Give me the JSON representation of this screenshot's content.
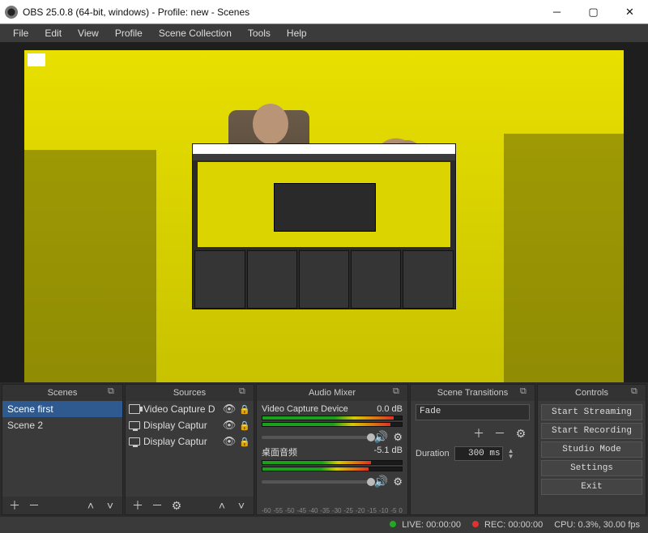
{
  "window": {
    "title": "OBS 25.0.8 (64-bit, windows) - Profile: new - Scenes"
  },
  "menu": [
    "File",
    "Edit",
    "View",
    "Profile",
    "Scene Collection",
    "Tools",
    "Help"
  ],
  "panels": {
    "scenes": {
      "title": "Scenes",
      "items": [
        "Scene first",
        "Scene 2"
      ],
      "selected": 0
    },
    "sources": {
      "title": "Sources",
      "items": [
        {
          "type": "cap",
          "label": "Video Capture D"
        },
        {
          "type": "disp",
          "label": "Display Captur"
        },
        {
          "type": "disp",
          "label": "Display Captur"
        }
      ]
    },
    "mixer": {
      "title": "Audio Mixer",
      "ticks": [
        "-60",
        "-55",
        "-50",
        "-45",
        "-40",
        "-35",
        "-30",
        "-25",
        "-20",
        "-15",
        "-10",
        "-5",
        "0"
      ],
      "channels": [
        {
          "name": "Video Capture Device",
          "db": "0.0 dB",
          "level": 94,
          "slider": 98
        },
        {
          "name": "桌面音频",
          "db": "-5.1 dB",
          "level": 78,
          "slider": 98
        }
      ]
    },
    "transitions": {
      "title": "Scene Transitions",
      "selected": "Fade",
      "duration_label": "Duration",
      "duration_value": "300 ms"
    },
    "controls": {
      "title": "Controls",
      "buttons": [
        "Start Streaming",
        "Start Recording",
        "Studio Mode",
        "Settings",
        "Exit"
      ]
    }
  },
  "status": {
    "live_label": "LIVE:",
    "live_time": "00:00:00",
    "rec_label": "REC:",
    "rec_time": "00:00:00",
    "cpu": "CPU: 0.3%, 30.00 fps"
  }
}
